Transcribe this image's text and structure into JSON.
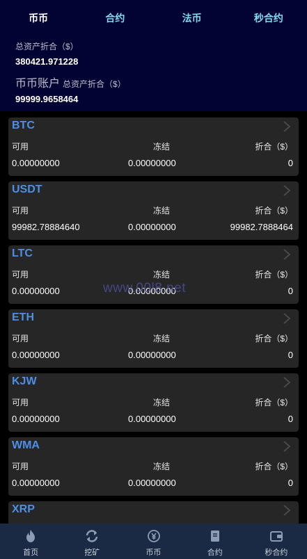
{
  "tabs": [
    "币币",
    "合约",
    "法币",
    "秒合约"
  ],
  "summary": {
    "total_label": "总资产折合（$）",
    "total_value": "380421.971228",
    "account_label": "币币账户",
    "account_sub": "总资产折合（$）",
    "account_value": "99999.9658464"
  },
  "columns": {
    "available": "可用",
    "frozen": "冻结",
    "converted": "折合（$）"
  },
  "assets": [
    {
      "coin": "BTC",
      "available": "0.00000000",
      "frozen": "0.00000000",
      "converted": "0"
    },
    {
      "coin": "USDT",
      "available": "99982.78884640",
      "frozen": "0.00000000",
      "converted": "99982.7888464"
    },
    {
      "coin": "LTC",
      "available": "0.00000000",
      "frozen": "0.00000000",
      "converted": "0"
    },
    {
      "coin": "ETH",
      "available": "0.00000000",
      "frozen": "0.00000000",
      "converted": "0"
    },
    {
      "coin": "KJW",
      "available": "0.00000000",
      "frozen": "0.00000000",
      "converted": "0"
    },
    {
      "coin": "WMA",
      "available": "0.00000000",
      "frozen": "0.00000000",
      "converted": "0"
    },
    {
      "coin": "XRP",
      "available": "",
      "frozen": "",
      "converted": ""
    }
  ],
  "watermark": "www.00l8.net",
  "bottom_nav": [
    {
      "label": "首页",
      "icon": "flame-icon"
    },
    {
      "label": "挖矿",
      "icon": "swap-icon"
    },
    {
      "label": "币币",
      "icon": "coin-icon"
    },
    {
      "label": "合约",
      "icon": "document-icon"
    },
    {
      "label": "秒合约",
      "icon": "wallet-icon"
    }
  ],
  "colors": {
    "header_bg": "#020233",
    "card_bg": "#262626",
    "coin_text": "#4d8fe6",
    "nav_bg": "#1b2a44",
    "tab_text": "#7fd9f0"
  }
}
